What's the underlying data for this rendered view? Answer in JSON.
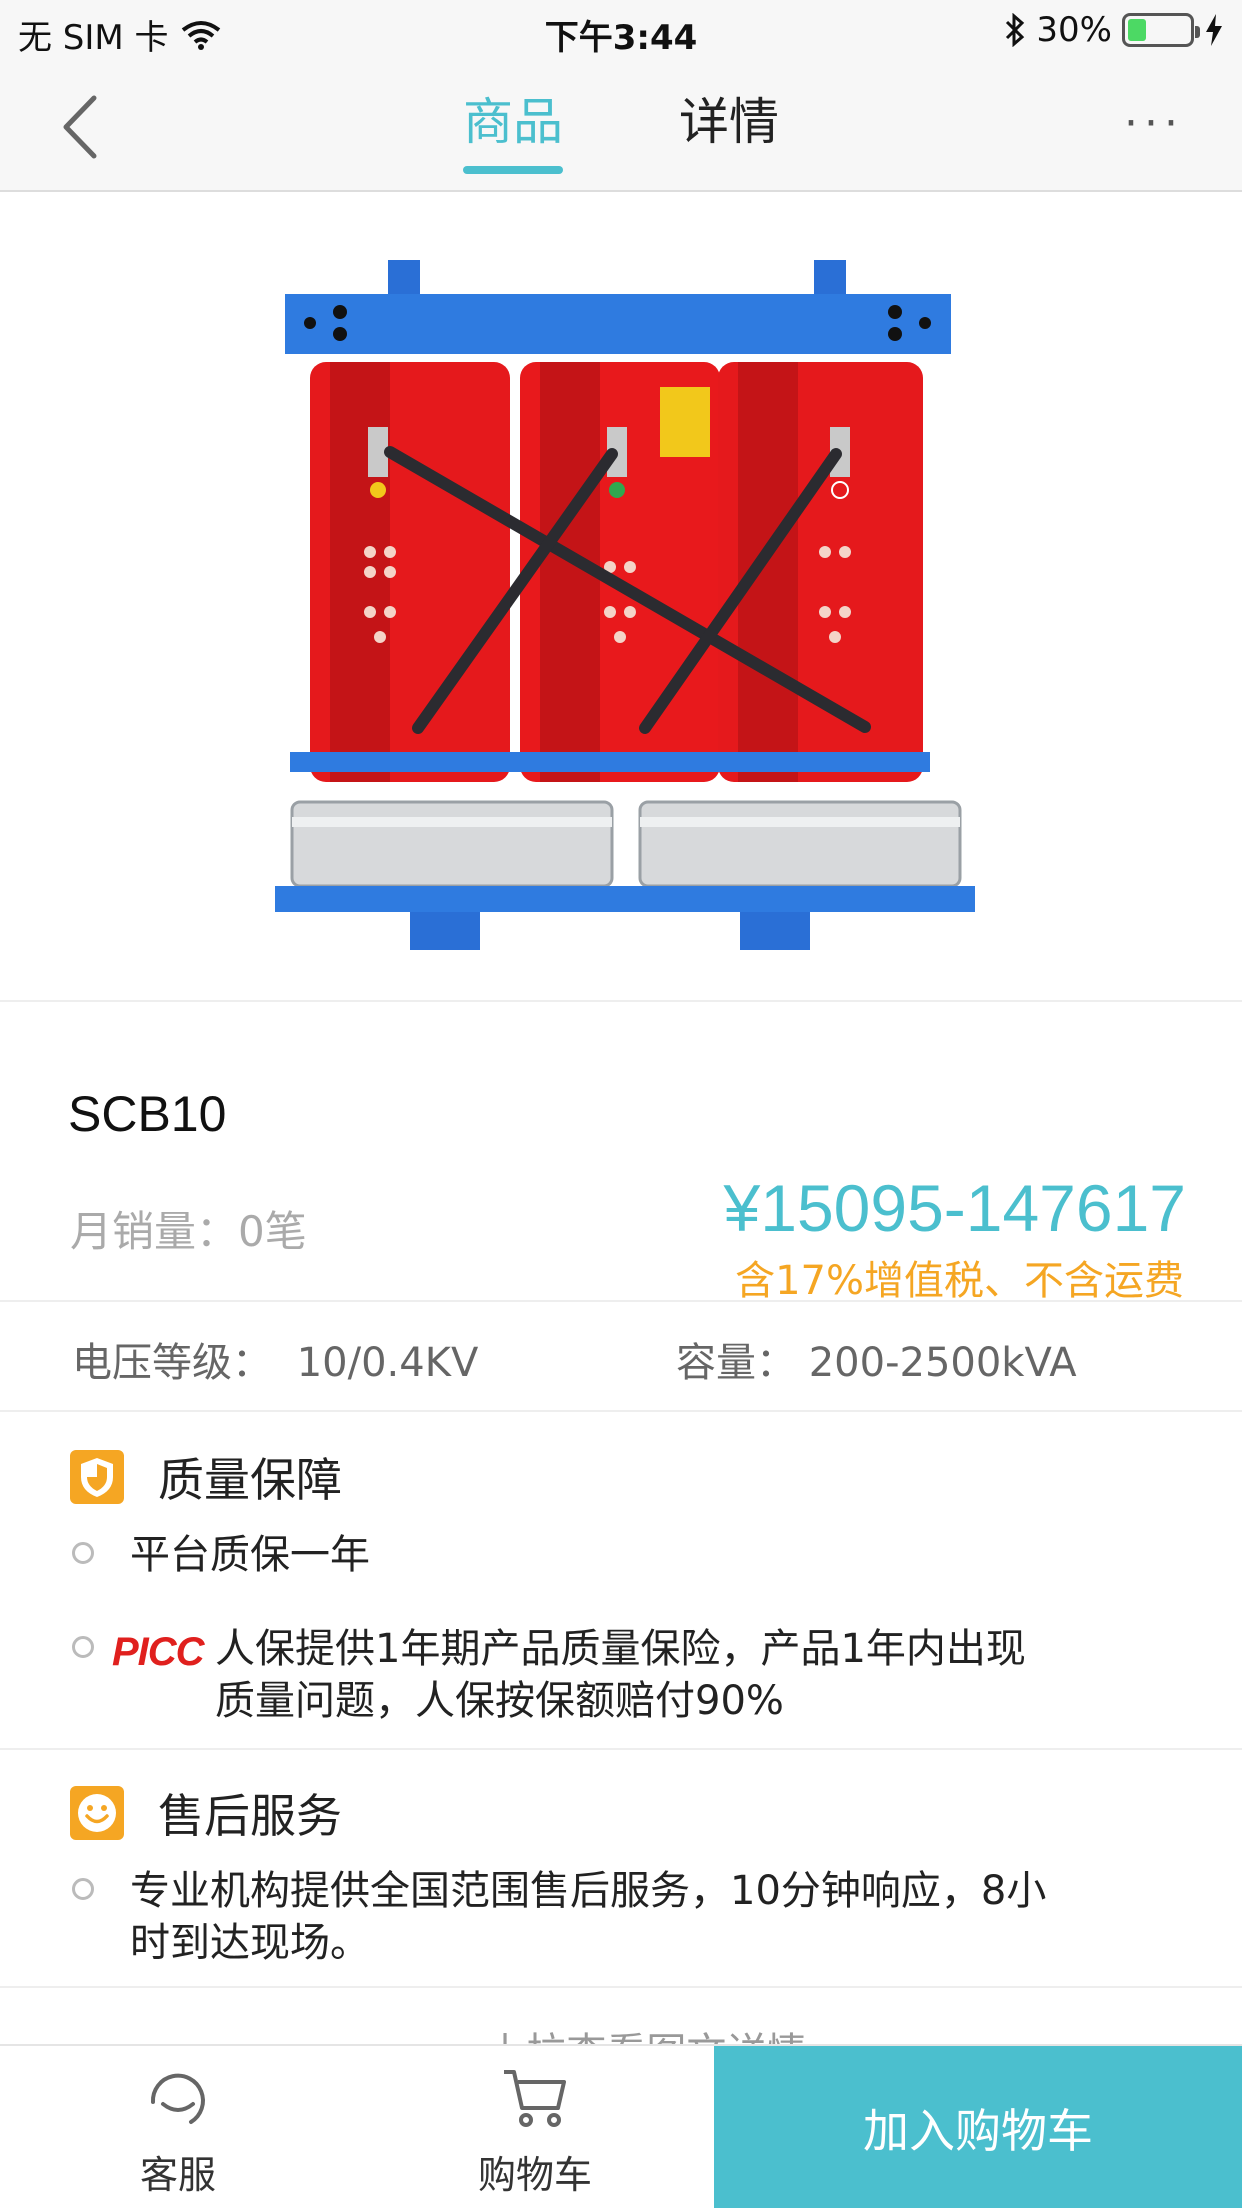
{
  "status_bar": {
    "carrier": "无 SIM 卡",
    "time": "下午3:44",
    "battery_percent": "30%",
    "battery_level": 0.3
  },
  "nav": {
    "tabs": [
      {
        "label": "商品",
        "active": true
      },
      {
        "label": "详情",
        "active": false
      }
    ],
    "more_label": "···"
  },
  "product": {
    "name": "SCB10",
    "monthly_sales": "月销量：0笔",
    "price": "¥15095-147617",
    "price_note": "含17%增值税、不含运费",
    "specs": [
      {
        "label": "电压等级：",
        "value": "10/0.4KV"
      },
      {
        "label": "容量：",
        "value": "200-2500kVA"
      }
    ]
  },
  "quality": {
    "title": "质量保障",
    "items": [
      "平台质保一年",
      "人保提供1年期产品质量保险，产品1年内出现",
      "质量问题，人保按保额赔付90%"
    ],
    "picc_logo": "PICC"
  },
  "after_sales": {
    "title": "售后服务",
    "items": [
      "专业机构提供全国范围售后服务，10分钟响应，8小",
      "时到达现场。"
    ]
  },
  "pull_hint": "···  上拉查看图文详情",
  "bottom_bar": {
    "service_label": "客服",
    "cart_label": "购物车",
    "add_cart_label": "加入购物车"
  },
  "colors": {
    "accent": "#4bbfce",
    "price_note": "#f5a623",
    "icon_bg": "#f5a623",
    "picc": "#e0201e"
  }
}
